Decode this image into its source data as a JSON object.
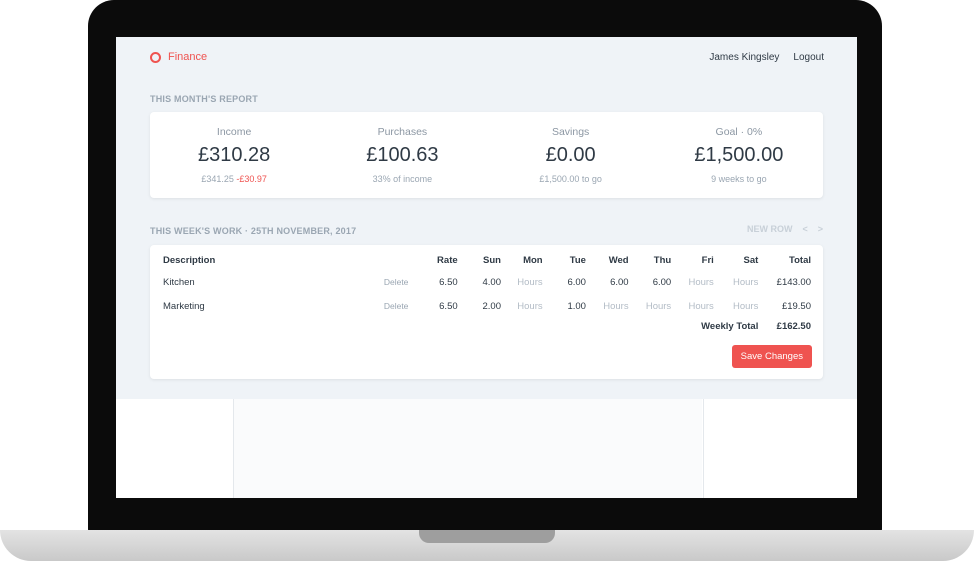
{
  "app": {
    "brand": "Finance",
    "user": "James Kingsley",
    "logout": "Logout",
    "accent": "#ef5350"
  },
  "report": {
    "heading": "THIS MONTH'S REPORT",
    "income": {
      "label": "Income",
      "value": "£310.28",
      "sub": "£341.25",
      "sub_neg": "-£30.97"
    },
    "purchases": {
      "label": "Purchases",
      "value": "£100.63",
      "sub": "33% of income"
    },
    "savings": {
      "label": "Savings",
      "value": "£0.00",
      "sub": "£1,500.00 to go"
    },
    "goal": {
      "label": "Goal · 0%",
      "value": "£1,500.00",
      "sub": "9 weeks to go"
    }
  },
  "week": {
    "heading": "THIS WEEK'S WORK · 25TH NOVEMBER, 2017",
    "new_row": "NEW ROW",
    "prev": "<",
    "next": ">",
    "columns": [
      "Description",
      "Rate",
      "Sun",
      "Mon",
      "Tue",
      "Wed",
      "Thu",
      "Fri",
      "Sat",
      "Total"
    ],
    "rows": [
      {
        "desc": "Kitchen",
        "delete": "Delete",
        "rate": "6.50",
        "sun": "4.00",
        "mon": "Hours",
        "tue": "6.00",
        "wed": "6.00",
        "thu": "6.00",
        "fri": "Hours",
        "sat": "Hours",
        "total": "£143.00"
      },
      {
        "desc": "Marketing",
        "delete": "Delete",
        "rate": "6.50",
        "sun": "2.00",
        "mon": "Hours",
        "tue": "1.00",
        "wed": "Hours",
        "thu": "Hours",
        "fri": "Hours",
        "sat": "Hours",
        "total": "£19.50"
      }
    ],
    "weekly_total_label": "Weekly Total",
    "weekly_total": "£162.50",
    "save": "Save Changes"
  }
}
